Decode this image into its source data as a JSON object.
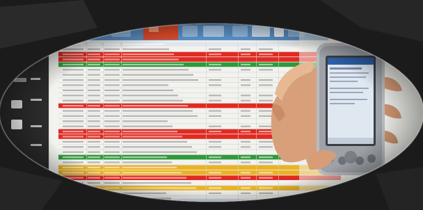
{
  "palette": {
    "page_bg": "#1b1b1b",
    "sheet_bg": "#f2f2ef",
    "ribbon": "#5a8fc4",
    "ribbon_tab_active": "#e04a2a",
    "row_red": "#e12a22",
    "row_green": "#2f9a3a",
    "row_yellow": "#e9b326",
    "text_gray": "#8a8a8a",
    "gridline": "#d2d2cc",
    "skin": "#d8a07a",
    "device_body": "#b9bcc0",
    "device_screen": "#dfe7f1"
  },
  "spreadsheet": {
    "row_status": [
      "header",
      "plain",
      "red",
      "red",
      "green",
      "plain",
      "plain",
      "plain",
      "plain",
      "plain",
      "plain",
      "plain",
      "red",
      "plain",
      "plain",
      "plain",
      "plain",
      "red",
      "red",
      "plain",
      "plain",
      "plain",
      "green",
      "plain",
      "yellow",
      "yellow",
      "red",
      "plain",
      "yellow",
      "plain",
      "plain",
      "plain",
      "plain"
    ]
  },
  "device": {
    "type": "handheld-pda"
  }
}
